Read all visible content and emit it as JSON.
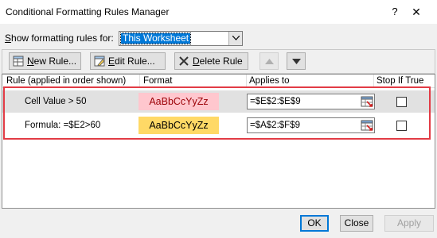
{
  "window": {
    "title": "Conditional Formatting Rules Manager",
    "help_glyph": "?",
    "close_glyph": "✕"
  },
  "show_rules": {
    "label_prefix": "",
    "label_underlined": "S",
    "label_rest": "how formatting rules for:",
    "selected": "This Worksheet"
  },
  "toolbar": {
    "new_rule": {
      "underline": "N",
      "rest": "ew Rule..."
    },
    "edit_rule": {
      "underline": "E",
      "rest": "dit Rule..."
    },
    "delete_rule": {
      "underline": "D",
      "rest": "elete Rule"
    }
  },
  "table": {
    "headers": {
      "rule": "Rule (applied in order shown)",
      "format": "Format",
      "applies_to": "Applies to",
      "stop_if_true": "Stop If True"
    },
    "rows": [
      {
        "rule": "Cell Value > 50",
        "format_preview": "AaBbCcYyZz",
        "applies_to": "=$E$2:$E$9",
        "stop_if_true": false,
        "fill_color": "#ffc7ce",
        "font_color": "#9c0006"
      },
      {
        "rule": "Formula: =$E2>60",
        "format_preview": "AaBbCcYyZz",
        "applies_to": "=$A$2:$F$9",
        "stop_if_true": false,
        "fill_color": "#ffd966",
        "font_color": "#000000"
      }
    ]
  },
  "buttons": {
    "ok": "OK",
    "close": "Close",
    "apply": "Apply"
  },
  "colors": {
    "highlight_border": "#e23b45",
    "selection": "#0078d7"
  }
}
